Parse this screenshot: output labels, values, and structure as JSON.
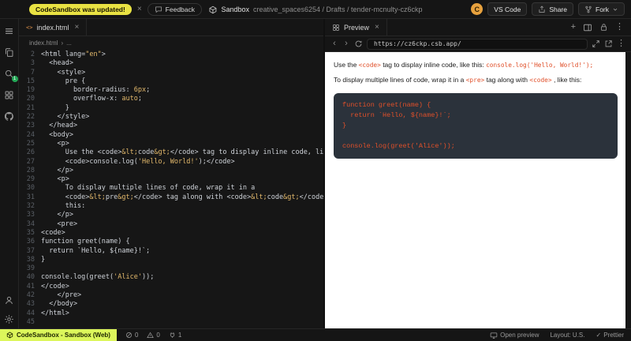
{
  "colors": {
    "accent": "#e0502a",
    "codeblock-bg": "#2b323b",
    "brand-yellow": "#e9e243",
    "status-lime": "#dcf65b",
    "badge-green": "#24a857",
    "avatar-orange": "#e8a23e"
  },
  "header": {
    "update_pill": "CodeSandbox was updated!",
    "feedback_label": "Feedback",
    "product_label": "Sandbox",
    "path": "creative_spaces6254 / Drafts / tender-mcnulty-cz6ckp",
    "avatar_initial": "C",
    "vscode_label": "VS Code",
    "share_label": "Share",
    "fork_label": "Fork"
  },
  "editor": {
    "tab_label": "index.html",
    "breadcrumb": {
      "file": "index.html",
      "separator": "›",
      "more": "..."
    },
    "lines": [
      {
        "n": "2",
        "segs": [
          [
            "w",
            "<html lang="
          ],
          [
            "g",
            "\"en\""
          ],
          [
            "w",
            ">"
          ]
        ]
      },
      {
        "n": "3",
        "segs": [
          [
            "w",
            "  <head>"
          ]
        ]
      },
      {
        "n": "7",
        "segs": [
          [
            "w",
            "    <style>"
          ]
        ]
      },
      {
        "n": "15",
        "segs": [
          [
            "w",
            "      pre {"
          ]
        ]
      },
      {
        "n": "19",
        "segs": [
          [
            "w",
            "        border-radius: "
          ],
          [
            "g",
            "6px"
          ],
          [
            "w",
            ";"
          ]
        ]
      },
      {
        "n": "20",
        "segs": [
          [
            "w",
            "        overflow-x: "
          ],
          [
            "g",
            "auto"
          ],
          [
            "w",
            ";"
          ]
        ]
      },
      {
        "n": "21",
        "segs": [
          [
            "w",
            "      }"
          ]
        ]
      },
      {
        "n": "22",
        "segs": [
          [
            "w",
            "    </style>"
          ]
        ]
      },
      {
        "n": "23",
        "segs": [
          [
            "w",
            "  </head>"
          ]
        ]
      },
      {
        "n": "24",
        "segs": [
          [
            "w",
            "  <body>"
          ]
        ]
      },
      {
        "n": "25",
        "segs": [
          [
            "w",
            "    <p>"
          ]
        ]
      },
      {
        "n": "26",
        "segs": [
          [
            "w",
            "      Use the <code>"
          ],
          [
            "g",
            "&lt;"
          ],
          [
            "w",
            "code"
          ],
          [
            "g",
            "&gt;"
          ],
          [
            "w",
            "</code> tag to display inline code, like this:"
          ]
        ]
      },
      {
        "n": "27",
        "segs": [
          [
            "w",
            "      <code>console.log("
          ],
          [
            "g",
            "'Hello, World!'"
          ],
          [
            "w",
            ");</code>"
          ]
        ]
      },
      {
        "n": "28",
        "segs": [
          [
            "w",
            "    </p>"
          ]
        ]
      },
      {
        "n": "29",
        "segs": [
          [
            "w",
            "    <p>"
          ]
        ]
      },
      {
        "n": "30",
        "segs": [
          [
            "w",
            "      To display multiple lines of code, wrap it in a"
          ]
        ]
      },
      {
        "n": "31",
        "segs": [
          [
            "w",
            "      <code>"
          ],
          [
            "g",
            "&lt;"
          ],
          [
            "w",
            "pre"
          ],
          [
            "g",
            "&gt;"
          ],
          [
            "w",
            "</code> tag along with <code>"
          ],
          [
            "g",
            "&lt;"
          ],
          [
            "w",
            "code"
          ],
          [
            "g",
            "&gt;"
          ],
          [
            "w",
            "</code>, like"
          ]
        ]
      },
      {
        "n": "32",
        "segs": [
          [
            "w",
            "      this:"
          ]
        ]
      },
      {
        "n": "33",
        "segs": [
          [
            "w",
            "    </p>"
          ]
        ]
      },
      {
        "n": "34",
        "segs": [
          [
            "w",
            "    <pre>"
          ]
        ]
      },
      {
        "n": "35",
        "segs": [
          [
            "w",
            "<code>"
          ]
        ]
      },
      {
        "n": "36",
        "segs": [
          [
            "w",
            "function greet(name) {"
          ]
        ]
      },
      {
        "n": "37",
        "segs": [
          [
            "w",
            "  return `Hello, ${name}!`;"
          ]
        ]
      },
      {
        "n": "38",
        "segs": [
          [
            "w",
            "}"
          ]
        ]
      },
      {
        "n": "39",
        "segs": []
      },
      {
        "n": "40",
        "segs": [
          [
            "w",
            "console.log(greet("
          ],
          [
            "g",
            "'Alice'"
          ],
          [
            "w",
            "));"
          ]
        ]
      },
      {
        "n": "41",
        "segs": [
          [
            "w",
            "</code>"
          ]
        ]
      },
      {
        "n": "42",
        "segs": [
          [
            "w",
            "    </pre>"
          ]
        ]
      },
      {
        "n": "43",
        "segs": [
          [
            "w",
            "  </body>"
          ]
        ]
      },
      {
        "n": "44",
        "segs": [
          [
            "w",
            "</html>"
          ]
        ]
      },
      {
        "n": "45",
        "segs": []
      }
    ]
  },
  "preview": {
    "tab_label": "Preview",
    "url": "https://cz6ckp.csb.app/",
    "paragraphs": [
      {
        "segments": [
          {
            "code": false,
            "text": "Use the "
          },
          {
            "code": true,
            "text": "<code>"
          },
          {
            "code": false,
            "text": " tag to display inline code, like this: "
          },
          {
            "code": true,
            "text": "console.log('Hello, World!');"
          }
        ]
      },
      {
        "segments": [
          {
            "code": false,
            "text": "To display multiple lines of code, wrap it in a "
          },
          {
            "code": true,
            "text": "<pre>"
          },
          {
            "code": false,
            "text": " tag along with "
          },
          {
            "code": true,
            "text": "<code>"
          },
          {
            "code": false,
            "text": " , like this:"
          }
        ]
      }
    ],
    "code_block": {
      "lines": [
        "function greet(name) {",
        "  return `Hello, ${name}!`;",
        "}",
        "",
        "console.log(greet('Alice'));"
      ]
    }
  },
  "statusbar": {
    "brand": "CodeSandbox - Sandbox (Web)",
    "errors": "0",
    "warnings": "0",
    "ports": "1",
    "open_preview": "Open preview",
    "layout": "Layout: U.S.",
    "prettier": "Prettier"
  }
}
